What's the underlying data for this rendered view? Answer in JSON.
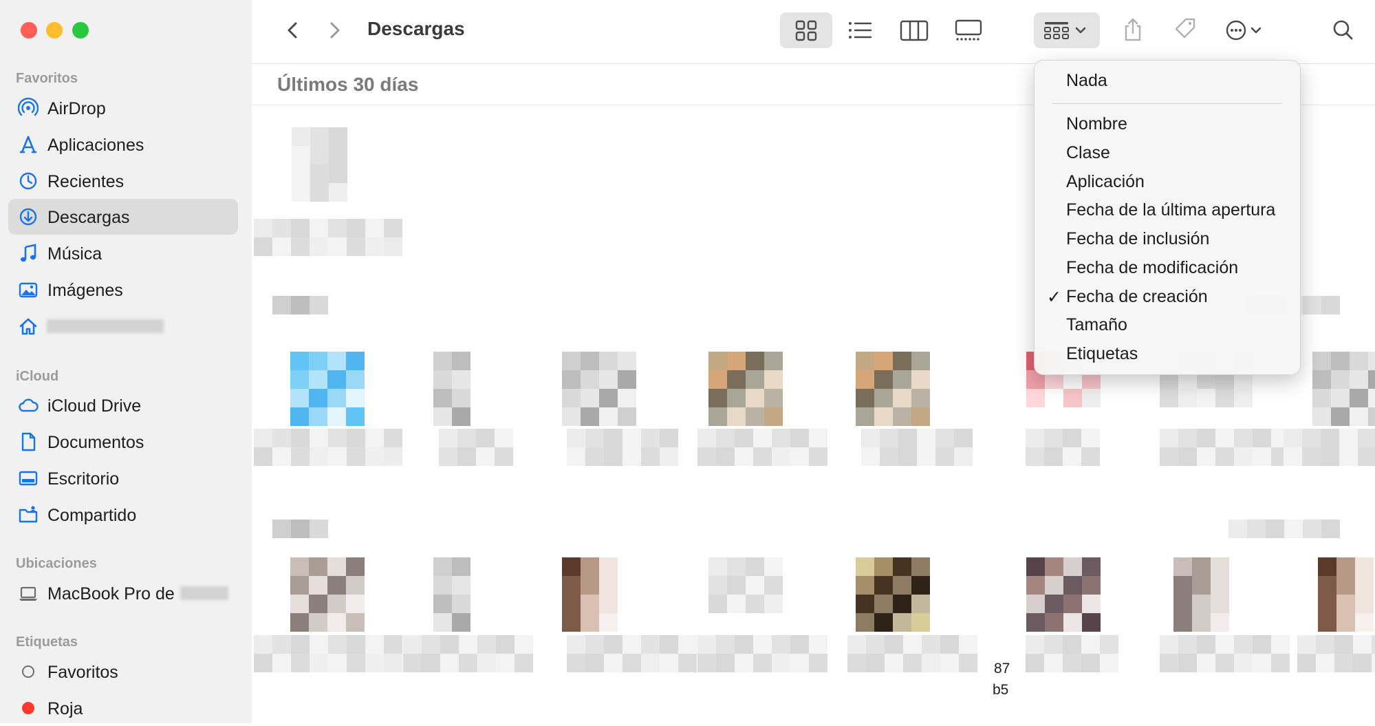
{
  "toolbar": {
    "title": "Descargas"
  },
  "sidebar": {
    "sections": {
      "favoritos": "Favoritos",
      "icloud": "iCloud",
      "ubicaciones": "Ubicaciones",
      "etiquetas": "Etiquetas"
    },
    "favoritos": [
      {
        "label": "AirDrop",
        "icon": "airdrop-icon"
      },
      {
        "label": "Aplicaciones",
        "icon": "applications-icon"
      },
      {
        "label": "Recientes",
        "icon": "clock-icon"
      },
      {
        "label": "Descargas",
        "icon": "download-icon",
        "selected": true
      },
      {
        "label": "Música",
        "icon": "music-note-icon"
      },
      {
        "label": "Imágenes",
        "icon": "photo-icon"
      },
      {
        "label": "",
        "icon": "home-icon"
      }
    ],
    "icloud": [
      {
        "label": "iCloud Drive",
        "icon": "cloud-icon"
      },
      {
        "label": "Documentos",
        "icon": "document-icon"
      },
      {
        "label": "Escritorio",
        "icon": "desktop-icon"
      },
      {
        "label": "Compartido",
        "icon": "shared-folder-icon"
      }
    ],
    "ubicaciones": [
      {
        "label": "MacBook Pro de",
        "icon": "laptop-icon"
      }
    ],
    "etiquetas": [
      {
        "label": "Favoritos",
        "icon": "tag-empty-circle-icon"
      },
      {
        "label": "Roja",
        "icon": "tag-red-dot-icon",
        "color": "#ff3b30"
      }
    ]
  },
  "content": {
    "section_title": "Últimos 30 días",
    "fragment_1": "87",
    "fragment_2": "b5"
  },
  "group_menu": {
    "items": [
      {
        "label": "Nada",
        "checked": false
      },
      {
        "label": "Nombre",
        "checked": false
      },
      {
        "label": "Clase",
        "checked": false
      },
      {
        "label": "Aplicación",
        "checked": false
      },
      {
        "label": "Fecha de la última apertura",
        "checked": false
      },
      {
        "label": "Fecha de inclusión",
        "checked": false
      },
      {
        "label": "Fecha de modificación",
        "checked": false
      },
      {
        "label": "Fecha de creación",
        "checked": true
      },
      {
        "label": "Tamaño",
        "checked": false
      },
      {
        "label": "Etiquetas",
        "checked": false
      }
    ],
    "checkmark": "✓"
  },
  "colors": {
    "accent": "#1a73e8",
    "close": "#ff5f57",
    "minimize": "#febc2e",
    "zoom": "#28c840",
    "tag_red": "#ff3b30"
  }
}
